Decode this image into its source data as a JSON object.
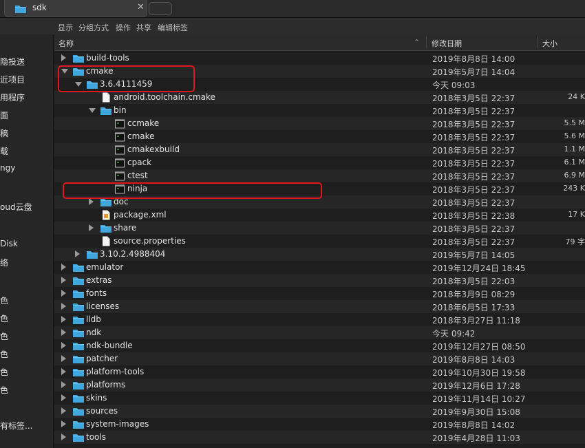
{
  "tab": {
    "title": "sdk",
    "close_glyph": "✕"
  },
  "toolbar": [
    "显示",
    "分组方式",
    "操作",
    "共享",
    "编辑标签"
  ],
  "sidebar": [
    "隐投送",
    "近项目",
    "用程序",
    "面",
    "稿",
    "载",
    "ngy",
    "oud云盘",
    "Disk",
    "络",
    "色",
    "色",
    "色",
    "色",
    "色",
    "色",
    "有标签..."
  ],
  "columns": {
    "name": "名称",
    "date": "修改日期",
    "size": "大小",
    "sort_glyph": "⌃"
  },
  "rows": [
    {
      "name": "build-tools",
      "date": "2019年8月8日 14:00",
      "size": "",
      "level": 0,
      "type": "folder",
      "disclosure": "closed"
    },
    {
      "name": "cmake",
      "date": "2019年5月7日 14:04",
      "size": "",
      "level": 0,
      "type": "folder",
      "disclosure": "open"
    },
    {
      "name": "3.6.4111459",
      "date": "今天 09:03",
      "size": "",
      "level": 1,
      "type": "folder",
      "disclosure": "open"
    },
    {
      "name": "android.toolchain.cmake",
      "date": "2018年3月5日 22:37",
      "size": "24 K",
      "level": 2,
      "type": "file",
      "disclosure": "none"
    },
    {
      "name": "bin",
      "date": "2018年3月5日 22:37",
      "size": "",
      "level": 2,
      "type": "folder",
      "disclosure": "open"
    },
    {
      "name": "ccmake",
      "date": "2018年3月5日 22:37",
      "size": "5.5 M",
      "level": 3,
      "type": "exec",
      "disclosure": "none"
    },
    {
      "name": "cmake",
      "date": "2018年3月5日 22:37",
      "size": "5.6 M",
      "level": 3,
      "type": "exec",
      "disclosure": "none"
    },
    {
      "name": "cmakexbuild",
      "date": "2018年3月5日 22:37",
      "size": "1.1 M",
      "level": 3,
      "type": "exec",
      "disclosure": "none"
    },
    {
      "name": "cpack",
      "date": "2018年3月5日 22:37",
      "size": "6.1 M",
      "level": 3,
      "type": "exec",
      "disclosure": "none"
    },
    {
      "name": "ctest",
      "date": "2018年3月5日 22:37",
      "size": "6.9 M",
      "level": 3,
      "type": "exec",
      "disclosure": "none"
    },
    {
      "name": "ninja",
      "date": "2018年3月5日 22:37",
      "size": "243 K",
      "level": 3,
      "type": "exec",
      "disclosure": "none"
    },
    {
      "name": "doc",
      "date": "2018年3月5日 22:37",
      "size": "",
      "level": 2,
      "type": "folder",
      "disclosure": "closed"
    },
    {
      "name": "package.xml",
      "date": "2018年3月5日 22:38",
      "size": "17 K",
      "level": 2,
      "type": "xml",
      "disclosure": "none"
    },
    {
      "name": "share",
      "date": "2018年3月5日 22:37",
      "size": "",
      "level": 2,
      "type": "folder",
      "disclosure": "closed"
    },
    {
      "name": "source.properties",
      "date": "2018年3月5日 22:37",
      "size": "79 字",
      "level": 2,
      "type": "file",
      "disclosure": "none"
    },
    {
      "name": "3.10.2.4988404",
      "date": "2019年5月7日 14:05",
      "size": "",
      "level": 1,
      "type": "folder",
      "disclosure": "closed"
    },
    {
      "name": "emulator",
      "date": "2019年12月24日 18:45",
      "size": "",
      "level": 0,
      "type": "folder",
      "disclosure": "closed"
    },
    {
      "name": "extras",
      "date": "2018年3月5日 22:03",
      "size": "",
      "level": 0,
      "type": "folder",
      "disclosure": "closed"
    },
    {
      "name": "fonts",
      "date": "2018年3月9日 08:29",
      "size": "",
      "level": 0,
      "type": "folder",
      "disclosure": "closed"
    },
    {
      "name": "licenses",
      "date": "2018年6月5日 17:33",
      "size": "",
      "level": 0,
      "type": "folder",
      "disclosure": "closed"
    },
    {
      "name": "lldb",
      "date": "2018年3月27日 11:18",
      "size": "",
      "level": 0,
      "type": "folder",
      "disclosure": "closed"
    },
    {
      "name": "ndk",
      "date": "今天 09:42",
      "size": "",
      "level": 0,
      "type": "folder",
      "disclosure": "closed"
    },
    {
      "name": "ndk-bundle",
      "date": "2019年12月27日 08:50",
      "size": "",
      "level": 0,
      "type": "folder",
      "disclosure": "closed"
    },
    {
      "name": "patcher",
      "date": "2019年8月8日 14:03",
      "size": "",
      "level": 0,
      "type": "folder",
      "disclosure": "closed"
    },
    {
      "name": "platform-tools",
      "date": "2019年10月30日 19:58",
      "size": "",
      "level": 0,
      "type": "folder",
      "disclosure": "closed"
    },
    {
      "name": "platforms",
      "date": "2019年12月6日 17:28",
      "size": "",
      "level": 0,
      "type": "folder",
      "disclosure": "closed"
    },
    {
      "name": "skins",
      "date": "2019年11月14日 10:27",
      "size": "",
      "level": 0,
      "type": "folder",
      "disclosure": "closed"
    },
    {
      "name": "sources",
      "date": "2019年9月30日 15:08",
      "size": "",
      "level": 0,
      "type": "folder",
      "disclosure": "closed"
    },
    {
      "name": "system-images",
      "date": "2019年8月8日 14:02",
      "size": "",
      "level": 0,
      "type": "folder",
      "disclosure": "closed"
    },
    {
      "name": "tools",
      "date": "2019年4月28日 11:03",
      "size": "",
      "level": 0,
      "type": "folder",
      "disclosure": "closed"
    }
  ],
  "annotations": {
    "highlight_color": "#e0171d"
  },
  "colors": {
    "folder": "#3fa7de",
    "folder_tab": "#6cc4ef"
  }
}
